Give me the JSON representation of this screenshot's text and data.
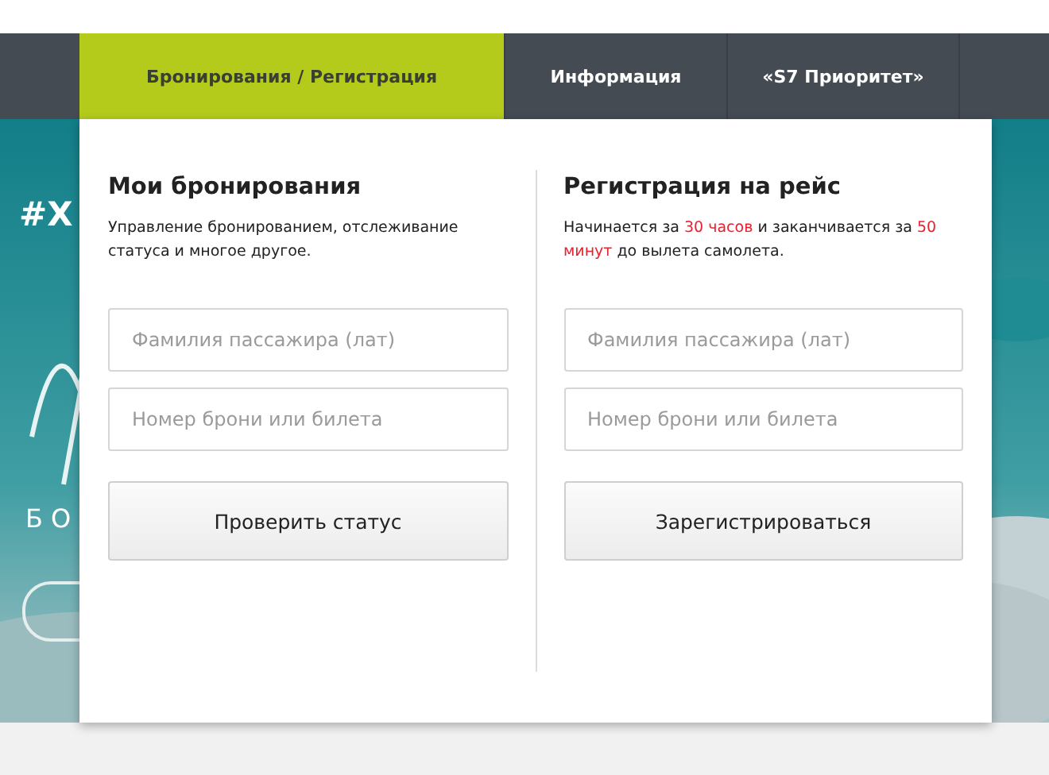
{
  "tabs": [
    {
      "label": "Бронирования / Регистрация",
      "selected": true
    },
    {
      "label": "Информация",
      "selected": false
    },
    {
      "label": "«S7 Приоритет»",
      "selected": false
    }
  ],
  "hero": {
    "hashtag": "#Х",
    "subtitle": "БО"
  },
  "columns": [
    {
      "title": "Мои бронирования",
      "description": [
        {
          "text": "Управление бронированием, отслеживание статуса и многое другое.",
          "highlight": false
        }
      ],
      "fields": [
        {
          "placeholder": "Фамилия пассажира (лат)"
        },
        {
          "placeholder": "Номер брони или билета"
        }
      ],
      "button": "Проверить статус"
    },
    {
      "title": "Регистрация на рейс",
      "description": [
        {
          "text": "Начинается за ",
          "highlight": false
        },
        {
          "text": "30 часов",
          "highlight": true
        },
        {
          "text": " и заканчивается за ",
          "highlight": false
        },
        {
          "text": "50 минут",
          "highlight": true
        },
        {
          "text": " до вылета самолета.",
          "highlight": false
        }
      ],
      "fields": [
        {
          "placeholder": "Фамилия пассажира (лат)"
        },
        {
          "placeholder": "Номер брони или билета"
        }
      ],
      "button": "Зарегистрироваться"
    }
  ]
}
